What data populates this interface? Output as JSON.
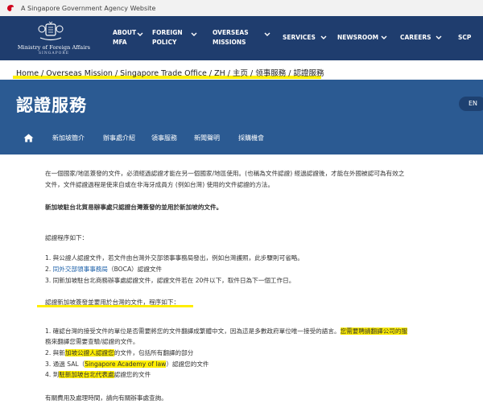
{
  "gov_banner": {
    "text": "A Singapore Government Agency Website"
  },
  "logo": {
    "name": "Ministry of Foreign Affairs",
    "sub": "SINGAPORE"
  },
  "nav": {
    "items": [
      {
        "line1": "ABOUT",
        "line2": "MFA"
      },
      {
        "line1": "FOREIGN",
        "line2": "POLICY"
      },
      {
        "line1": "OVERSEAS",
        "line2": "MISSIONS"
      },
      {
        "line1": "SERVICES",
        "line2": ""
      },
      {
        "line1": "NEWSROOM",
        "line2": ""
      },
      {
        "line1": "CAREERS",
        "line2": ""
      },
      {
        "line1": "SCP",
        "line2": ""
      }
    ]
  },
  "breadcrumb": {
    "text": "Home / Overseas Mission / Singapore Trade Office / ZH / 主页 / 领事服務 / 認證服務"
  },
  "banner": {
    "title": "認證服務",
    "lang": "EN"
  },
  "subnav": {
    "items": [
      "新加坡簡介",
      "辦事處介紹",
      "領事服務",
      "新聞聲明",
      "採購機會"
    ]
  },
  "content": {
    "intro_line1": "在一個國家/地區簽發的文件，必須經過認證才能在另一個國家/地區使用。(也稱為文件認證) 經過認證後，才能在外國被認可為有效之",
    "intro_line2": "文件，文件認證過程是使來自或在非海牙成員方 (例如台灣) 使用的文件認證的方法。",
    "note": "新加坡駐台北貿易辦事處只認證台灣簽發的並用於新加坡的文件。",
    "proc_title": "認證程序如下：",
    "proc1": "1. 與公證人認證文件，若文件由台灣外交部領事事務局發出，例如台灣護照，此步驟則可省略。",
    "proc2_prefix": "2. ",
    "proc2_link": "同外交部領事事務局",
    "proc2_suffix": "（BOCA）認證文件",
    "proc3": "3. 同新加坡駐台北商務辦事處認證文件，認證文件若在 20件以下，取件日為下一個工作日。",
    "sg_title": "認證新加坡簽發並要用於台灣的文件，程序如下：",
    "sg1_a": "1. 確認台灣的接受文件的單位是否需要將您的文件翻譯成繁體中文，因為這是多數政府單位唯一接受的語言。",
    "sg1_b": "您需要聘請翻譯公司的服",
    "sg1_c": "務來翻譯您需要查驗/認證的文件。",
    "sg2_a": "2. 與新",
    "sg2_b": "加坡公證人認證您",
    "sg2_c": "的文件，包括所有翻譯的部分",
    "sg3_a": "3. 通過 SAL（",
    "sg3_b": "Singapore Academy of law",
    "sg3_c": "）認證您的文件",
    "sg4_a": "4. 到",
    "sg4_b": "駐新加坡台北代表處",
    "sg4_c": "認證您的文件",
    "fees": "有關費用及處理時間，請向有關辦事處查詢。"
  },
  "colors": {
    "nav_bg": "#1f3d6e",
    "banner_bg": "#2b5a92",
    "highlight": "#ffee00",
    "link": "#1a5fa8"
  }
}
